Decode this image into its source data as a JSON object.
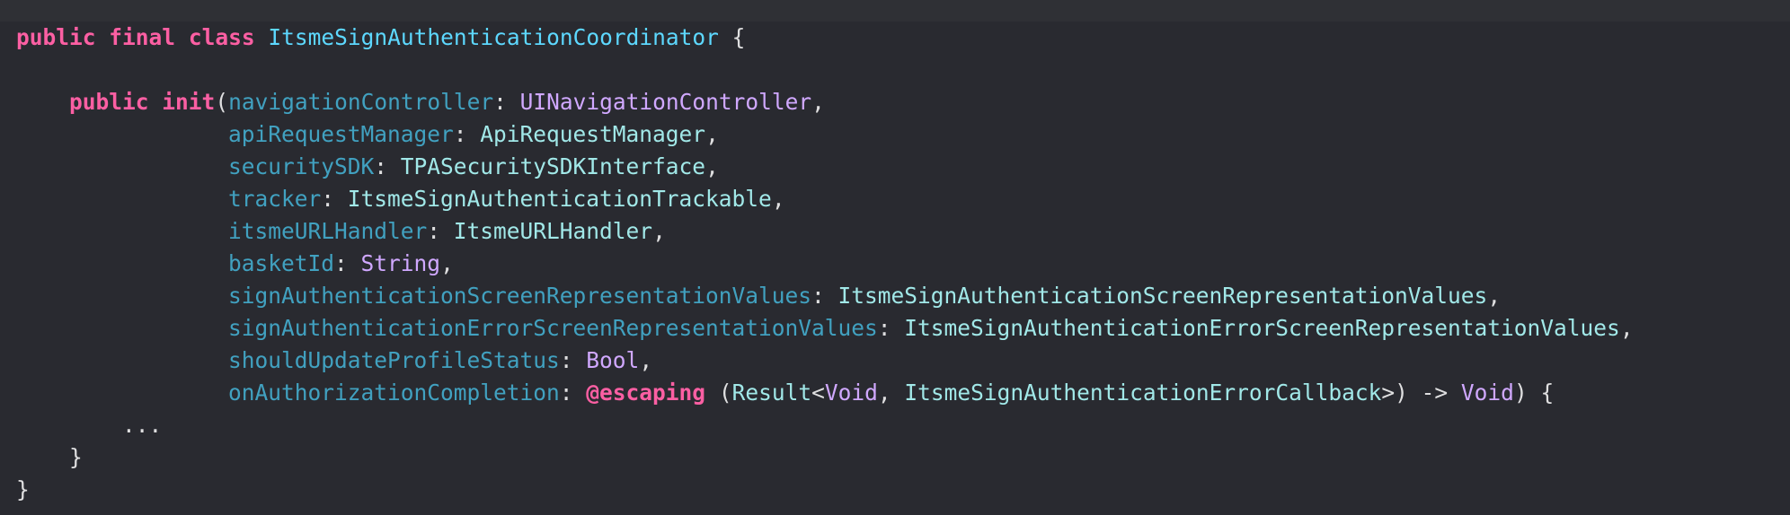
{
  "editor": {
    "theme_colors": {
      "background": "#292a30",
      "keyword": "#fc5fa3",
      "type_declaration": "#5dd8ff",
      "system_type": "#d0a8ff",
      "parameter": "#41a1c0",
      "project_type": "#a1e8e8",
      "plain": "#dfdfe0"
    },
    "lines": [
      {
        "tokens": [
          "public",
          " ",
          "final",
          " ",
          "class",
          " ",
          "ItsmeSignAuthenticationCoordinator",
          " {"
        ]
      },
      {
        "tokens": []
      },
      {
        "tokens": [
          "    ",
          "public",
          " ",
          "init",
          "(",
          "navigationController",
          ": ",
          "UINavigationController",
          ","
        ]
      },
      {
        "tokens": [
          "                ",
          "apiRequestManager",
          ": ",
          "ApiRequestManager",
          ","
        ]
      },
      {
        "tokens": [
          "                ",
          "securitySDK",
          ": ",
          "TPASecuritySDKInterface",
          ","
        ]
      },
      {
        "tokens": [
          "                ",
          "tracker",
          ": ",
          "ItsmeSignAuthenticationTrackable",
          ","
        ]
      },
      {
        "tokens": [
          "                ",
          "itsmeURLHandler",
          ": ",
          "ItsmeURLHandler",
          ","
        ]
      },
      {
        "tokens": [
          "                ",
          "basketId",
          ": ",
          "String",
          ","
        ]
      },
      {
        "tokens": [
          "                ",
          "signAuthenticationScreenRepresentationValues",
          ": ",
          "ItsmeSignAuthenticationScreenRepresentationValues",
          ","
        ]
      },
      {
        "tokens": [
          "                ",
          "signAuthenticationErrorScreenRepresentationValues",
          ": ",
          "ItsmeSignAuthenticationErrorScreenRepresentationValues",
          ","
        ]
      },
      {
        "tokens": [
          "                ",
          "shouldUpdateProfileStatus",
          ": ",
          "Bool",
          ","
        ]
      },
      {
        "tokens": [
          "                ",
          "onAuthorizationCompletion",
          ": ",
          "@escaping",
          " (",
          "Result",
          "<",
          "Void",
          ", ",
          "ItsmeSignAuthenticationErrorCallback",
          ">) -> ",
          "Void",
          ") {"
        ]
      },
      {
        "tokens": [
          "        ",
          "..."
        ]
      },
      {
        "tokens": [
          "    ",
          "}"
        ]
      },
      {
        "tokens": [
          "}"
        ]
      }
    ]
  }
}
